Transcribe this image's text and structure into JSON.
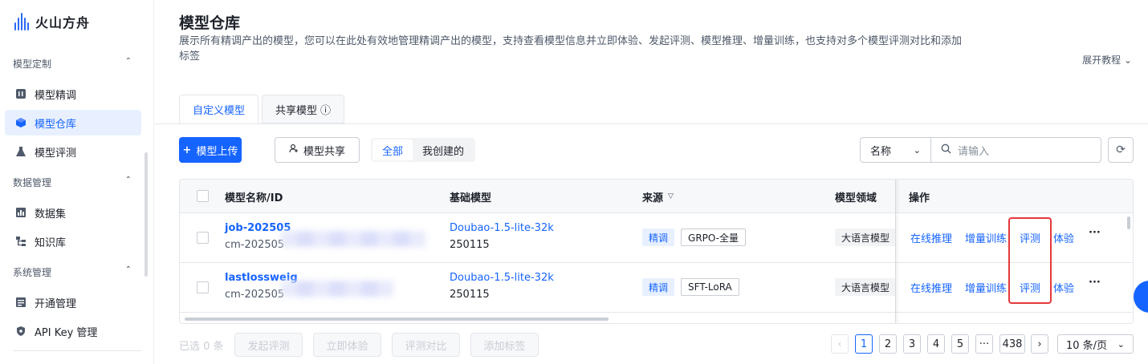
{
  "brand": {
    "name": "火山方舟",
    "accent": "#1664ff"
  },
  "sidebar": {
    "groups": [
      {
        "title": "模型定制",
        "items": [
          {
            "label": "模型精调",
            "icon": "tune-icon"
          },
          {
            "label": "模型仓库",
            "icon": "cube-icon",
            "active": true
          },
          {
            "label": "模型评测",
            "icon": "flask-icon"
          }
        ]
      },
      {
        "title": "数据管理",
        "items": [
          {
            "label": "数据集",
            "icon": "bar-chart-icon"
          },
          {
            "label": "知识库",
            "icon": "hierarchy-icon"
          }
        ]
      },
      {
        "title": "系统管理",
        "items": [
          {
            "label": "开通管理",
            "icon": "list-icon"
          },
          {
            "label": "API Key 管理",
            "icon": "shield-icon"
          }
        ]
      }
    ]
  },
  "page": {
    "title": "模型仓库",
    "description": "展示所有精调产出的模型，您可以在此处有效地管理精调产出的模型，支持查看模型信息并立即体验、发起评测、模型推理、增量训练，也支持对多个模型评测对比和添加标签",
    "tutorial": "展开教程"
  },
  "tabs": [
    {
      "label": "自定义模型",
      "active": true
    },
    {
      "label": "共享模型",
      "info": "ⓘ"
    }
  ],
  "toolbar": {
    "upload": "模型上传",
    "share": "模型共享",
    "filter_all": "全部",
    "filter_mine": "我创建的",
    "search_field": "名称",
    "search_placeholder": "请输入"
  },
  "table": {
    "headers": {
      "name": "模型名称/ID",
      "base": "基础模型",
      "source": "来源",
      "domain": "模型领域",
      "ops": "操作"
    },
    "rows": [
      {
        "name": "job-202505",
        "id": "cm-202505",
        "base_line1": "Doubao-1.5-lite-32k",
        "base_line2": "250115",
        "source_tag": "精调",
        "method_tag": "GRPO-全量",
        "domain": "大语言模型",
        "ops": {
          "infer": "在线推理",
          "train": "增量训练",
          "eval": "评测",
          "try": "体验",
          "more": "···"
        }
      },
      {
        "name": "lastlossweig",
        "id": "cm-202505",
        "base_line1": "Doubao-1.5-lite-32k",
        "base_line2": "250115",
        "source_tag": "精调",
        "method_tag": "SFT-LoRA",
        "domain": "大语言模型",
        "ops": {
          "infer": "在线推理",
          "train": "增量训练",
          "eval": "评测",
          "try": "体验",
          "more": "···"
        }
      }
    ]
  },
  "footer": {
    "selected": "已选 0 条",
    "actions": [
      "发起评测",
      "立即体验",
      "评测对比",
      "添加标签"
    ],
    "pages": [
      "1",
      "2",
      "3",
      "4",
      "5",
      "···",
      "438"
    ],
    "page_size": "10 条/页",
    "prev": "‹",
    "next": "›"
  }
}
